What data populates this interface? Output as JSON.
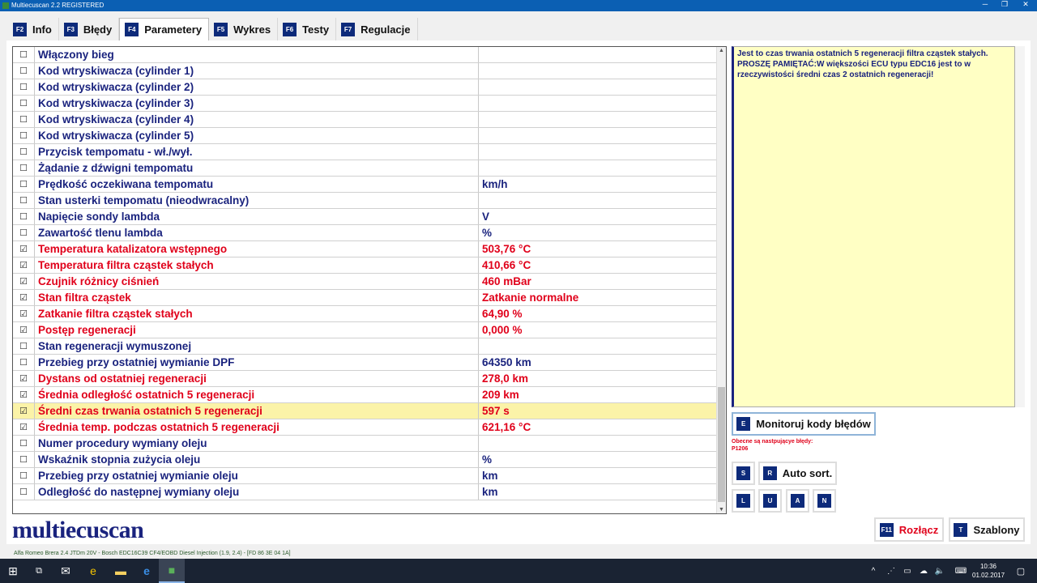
{
  "window": {
    "title": "Multiecuscan 2.2 REGISTERED"
  },
  "tabs": [
    {
      "key": "F2",
      "label": "Info"
    },
    {
      "key": "F3",
      "label": "Błędy"
    },
    {
      "key": "F4",
      "label": "Parametery",
      "active": true
    },
    {
      "key": "F5",
      "label": "Wykres"
    },
    {
      "key": "F6",
      "label": "Testy"
    },
    {
      "key": "F7",
      "label": "Regulacje"
    }
  ],
  "rows": [
    {
      "name": "Włączony bieg",
      "value": "",
      "checked": false
    },
    {
      "name": "Kod wtryskiwacza (cylinder 1)",
      "value": "",
      "checked": false
    },
    {
      "name": "Kod wtryskiwacza (cylinder 2)",
      "value": "",
      "checked": false
    },
    {
      "name": "Kod wtryskiwacza (cylinder 3)",
      "value": "",
      "checked": false
    },
    {
      "name": "Kod wtryskiwacza (cylinder 4)",
      "value": "",
      "checked": false
    },
    {
      "name": "Kod wtryskiwacza (cylinder 5)",
      "value": "",
      "checked": false
    },
    {
      "name": "Przycisk tempomatu - wł./wył.",
      "value": "",
      "checked": false
    },
    {
      "name": "Żądanie z dźwigni tempomatu",
      "value": "",
      "checked": false
    },
    {
      "name": "Prędkość oczekiwana tempomatu",
      "value": "km/h",
      "checked": false
    },
    {
      "name": "Stan usterki tempomatu (nieodwracalny)",
      "value": "",
      "checked": false
    },
    {
      "name": "Napięcie sondy lambda",
      "value": "V",
      "checked": false
    },
    {
      "name": "Zawartość tlenu lambda",
      "value": "%",
      "checked": false
    },
    {
      "name": "Temperatura katalizatora wstępnego",
      "value": "503,76 °C",
      "checked": true
    },
    {
      "name": "Temperatura filtra cząstek stałych",
      "value": "410,66 °C",
      "checked": true
    },
    {
      "name": "Czujnik różnicy ciśnień",
      "value": "460 mBar",
      "checked": true
    },
    {
      "name": "Stan filtra cząstek",
      "value": "Zatkanie normalne",
      "checked": true
    },
    {
      "name": "Zatkanie filtra cząstek stałych",
      "value": "64,90 %",
      "checked": true
    },
    {
      "name": "Postęp regeneracji",
      "value": "0,000 %",
      "checked": true
    },
    {
      "name": "Stan regeneracji wymuszonej",
      "value": "",
      "checked": false
    },
    {
      "name": "Przebieg przy ostatniej wymianie DPF",
      "value": "64350 km",
      "checked": false
    },
    {
      "name": "Dystans od ostatniej regeneracji",
      "value": "278,0 km",
      "checked": true
    },
    {
      "name": "Średnia odległość ostatnich 5 regeneracji",
      "value": "209 km",
      "checked": true
    },
    {
      "name": "Średni czas trwania ostatnich 5 regeneracji",
      "value": "597 s",
      "checked": true,
      "selected": true
    },
    {
      "name": "Średnia temp. podczas ostatnich 5 regeneracji",
      "value": "621,16 °C",
      "checked": true
    },
    {
      "name": "Numer procedury wymiany oleju",
      "value": "",
      "checked": false
    },
    {
      "name": "Wskaźnik stopnia zużycia oleju",
      "value": "%",
      "checked": false
    },
    {
      "name": "Przebieg przy ostatniej wymianie oleju",
      "value": "km",
      "checked": false
    },
    {
      "name": "Odległość do następnej wymiany oleju",
      "value": "km",
      "checked": false
    }
  ],
  "info_text": "Jest to czas trwania ostatnich 5 regeneracji filtra cząstek stałych. PROSZĘ PAMIĘTAĆ:W większości ECU typu EDC16 jest to w rzeczywistości średni czas 2 ostatnich regeneracji!",
  "monitor": {
    "key": "E",
    "label": "Monitoruj kody błędów"
  },
  "errors": {
    "title": "Obecne są nastpującye błędy:",
    "code": "P1206"
  },
  "buttons": {
    "s_key": "S",
    "autosort_key": "R",
    "autosort_label": "Auto sort.",
    "l": "L",
    "u": "U",
    "a": "A",
    "n": "N",
    "disconnect_key": "F11",
    "disconnect_label": "Rozłącz",
    "templates_key": "T",
    "templates_label": "Szablony"
  },
  "logo": "multiecuscan",
  "status": "Alfa Romeo Brera 2.4 JTDm 20V - Bosch EDC16C39 CF4/EOBD Diesel Injection (1.9, 2.4) - [FD 86 3E 04 1A]",
  "clock": {
    "time": "10:36",
    "date": "01.02.2017"
  },
  "colors": {
    "accent": "#1a237e",
    "alert": "#e0001a",
    "selected": "#fbf3a8",
    "info_bg": "#ffffc4"
  }
}
